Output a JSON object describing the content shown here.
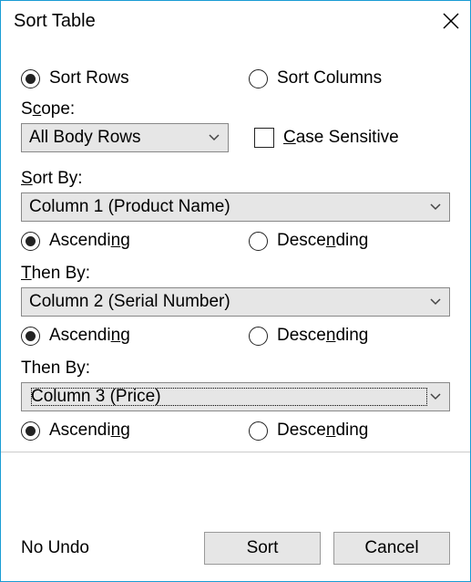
{
  "title": "Sort Table",
  "direction": {
    "rows": "Sort Rows",
    "columns": "Sort Columns",
    "selected": "rows"
  },
  "scope": {
    "label_pre": "S",
    "label_u": "c",
    "label_post": "ope:",
    "value": "All Body Rows"
  },
  "case_sensitive": {
    "label_u": "C",
    "label_post": "ase Sensitive",
    "checked": false
  },
  "sort_by": {
    "label_u": "S",
    "label_post": "ort By:",
    "value": "Column 1 (Product Name)",
    "asc_pre": "Ascendi",
    "asc_u": "n",
    "asc_post": "g",
    "desc_pre": "Desce",
    "desc_u": "n",
    "desc_post": "ding",
    "order": "asc"
  },
  "then_by_1": {
    "label_u": "T",
    "label_post": "hen By:",
    "value": "Column 2 (Serial Number)",
    "asc_pre": "Ascendi",
    "asc_u": "n",
    "asc_post": "g",
    "desc_pre": "Desce",
    "desc_u": "n",
    "desc_post": "ding",
    "order": "asc"
  },
  "then_by_2": {
    "label": "Then By:",
    "value": "Column 3 (Price)",
    "asc_pre": "Ascendi",
    "asc_u": "n",
    "asc_post": "g",
    "desc_pre": "Desce",
    "desc_u": "n",
    "desc_post": "ding",
    "order": "asc"
  },
  "footer": {
    "no_undo": "No Undo",
    "sort": "Sort",
    "cancel": "Cancel"
  }
}
